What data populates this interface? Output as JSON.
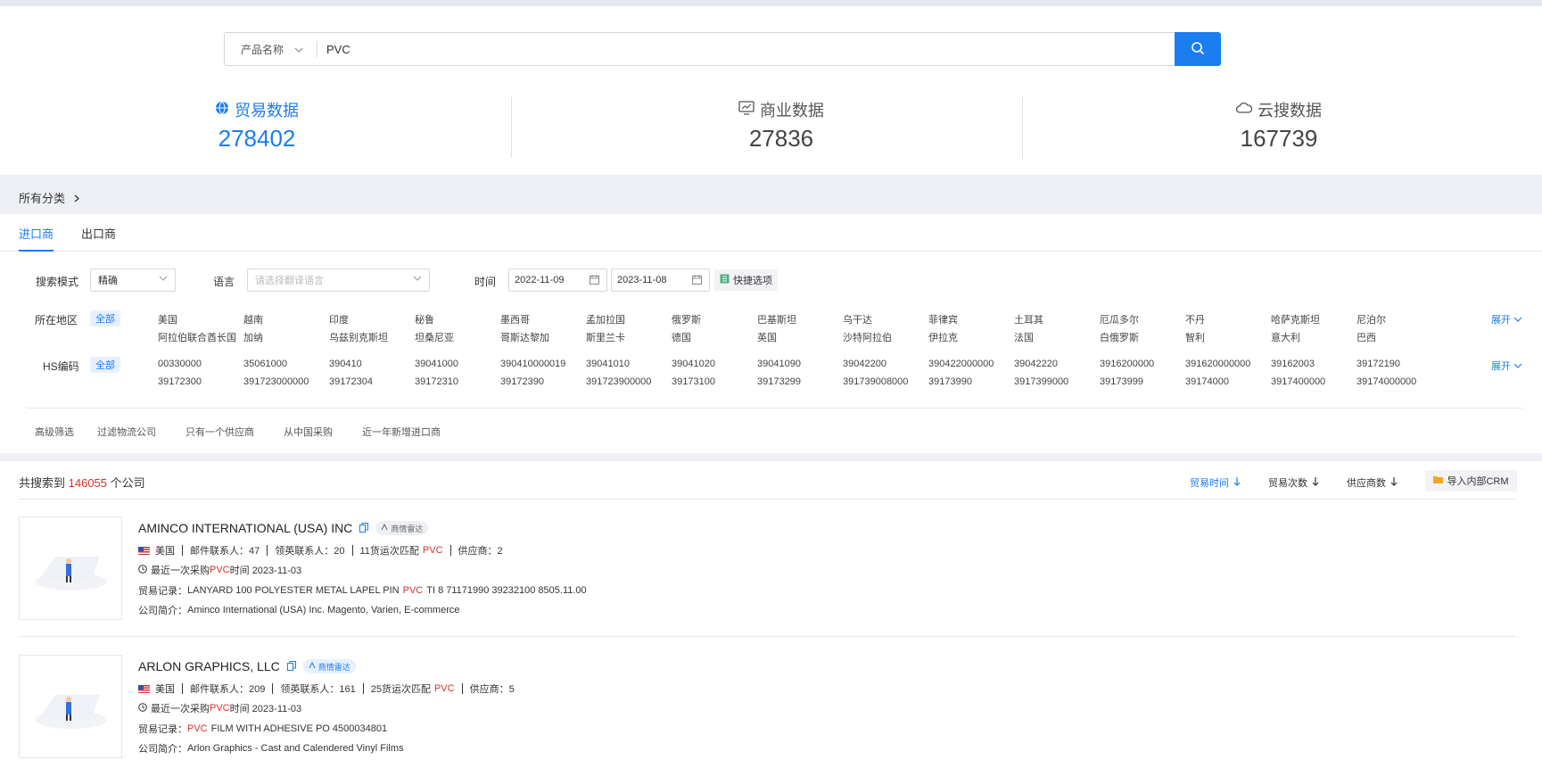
{
  "search": {
    "category": "产品名称",
    "query": "PVC"
  },
  "stats": [
    {
      "label": "贸易数据",
      "value": "278402",
      "icon": "globe-icon",
      "active": true
    },
    {
      "label": "商业数据",
      "value": "27836",
      "icon": "chart-monitor-icon",
      "active": false
    },
    {
      "label": "云搜数据",
      "value": "167739",
      "icon": "cloud-search-icon",
      "active": false
    }
  ],
  "breadcrumb": "所有分类",
  "tabs": [
    "进口商",
    "出口商"
  ],
  "filters": {
    "mode_label": "搜索模式",
    "mode_value": "精确",
    "lang_label": "语言",
    "lang_placeholder": "请选择翻译语言",
    "time_label": "时间",
    "date_start": "2022-11-09",
    "date_end": "2023-11-08",
    "quick_label": "快捷选项",
    "region_label": "所在地区",
    "all_label": "全部",
    "expand_label": "展开",
    "regions_row1": [
      "美国",
      "越南",
      "印度",
      "秘鲁",
      "墨西哥",
      "孟加拉国",
      "俄罗斯",
      "巴基斯坦",
      "乌干达",
      "菲律宾",
      "土耳其",
      "厄瓜多尔",
      "不丹",
      "哈萨克斯坦",
      "尼泊尔"
    ],
    "regions_row2": [
      "阿拉伯联合酋长国",
      "加纳",
      "乌兹别克斯坦",
      "坦桑尼亚",
      "哥斯达黎加",
      "斯里兰卡",
      "德国",
      "英国",
      "沙特阿拉伯",
      "伊拉克",
      "法国",
      "白俄罗斯",
      "智利",
      "意大利",
      "巴西"
    ],
    "hs_label": "HS编码",
    "hs_row1": [
      "00330000",
      "35061000",
      "390410",
      "39041000",
      "390410000019",
      "39041010",
      "39041020",
      "39041090",
      "39042200",
      "390422000000",
      "39042220",
      "3916200000",
      "391620000000",
      "39162003",
      "39172190"
    ],
    "hs_row2": [
      "39172300",
      "391723000000",
      "39172304",
      "39172310",
      "39172390",
      "391723900000",
      "39173100",
      "39173299",
      "391739008000",
      "39173990",
      "3917399000",
      "39173999",
      "39174000",
      "3917400000",
      "39174000000"
    ],
    "advanced_label": "高级筛选",
    "advanced": [
      "过滤物流公司",
      "只有一个供应商",
      "从中国采购",
      "近一年新增进口商"
    ]
  },
  "results": {
    "total_prefix": "共搜索到",
    "total_count": "146055",
    "total_suffix": "个公司",
    "sorts": [
      "贸易时间",
      "贸易次数",
      "供应商数"
    ],
    "crm_button": "导入内部CRM",
    "companies": [
      {
        "name": "AMINCO INTERNATIONAL (USA) INC",
        "radar": "商情雷达",
        "country": "美国",
        "mail_contacts": "邮件联系人：47",
        "linkedin_contacts": "领英联系人：20",
        "match_prefix": "11货运次匹配",
        "match_term": "PVC",
        "suppliers": "供应商：2",
        "last_prefix": "最近一次采购",
        "last_term": "PVC",
        "last_suffix": "时间 2023-11-03",
        "trade_label": "贸易记录：",
        "trade_pre": "LANYARD 100 POLYESTER METAL LAPEL PIN",
        "trade_term": "PVC",
        "trade_post": "TI 8 71171990 39232100 8505.11.00",
        "intro_label": "公司简介：",
        "intro": "Aminco International (USA) Inc. Magento, Varien, E-commerce"
      },
      {
        "name": "ARLON GRAPHICS, LLC",
        "radar": "商情雷达",
        "country": "美国",
        "mail_contacts": "邮件联系人：209",
        "linkedin_contacts": "领英联系人：161",
        "match_prefix": "25货运次匹配",
        "match_term": "PVC",
        "suppliers": "供应商：5",
        "last_prefix": "最近一次采购",
        "last_term": "PVC",
        "last_suffix": "时间 2023-11-03",
        "trade_label": "贸易记录：",
        "trade_pre": "",
        "trade_term": "PVC",
        "trade_post": "FILM WITH ADHESIVE PO 4500034801",
        "intro_label": "公司简介：",
        "intro": "Arlon Graphics - Cast and Calendered Vinyl Films"
      }
    ]
  },
  "colors": {
    "accent": "#1a7df0",
    "highlight": "#d93026"
  }
}
